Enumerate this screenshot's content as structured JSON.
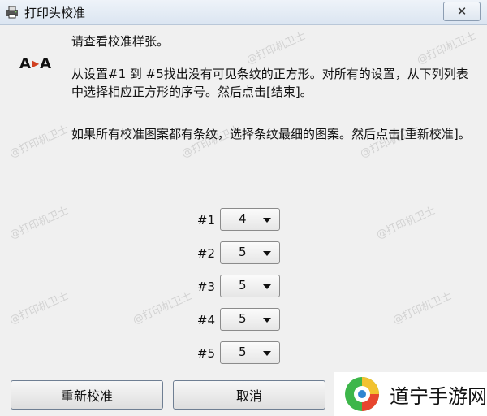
{
  "window": {
    "title": "打印头校准",
    "close_label": "✕",
    "logo_left": "A",
    "logo_right": "A"
  },
  "instructions": {
    "line1": "请查看校准样张。",
    "line2": "从设置#1 到 #5找出没有可见条纹的正方形。对所有的设置，从下列列表中选择相应正方形的序号。然后点击[结束]。",
    "line3": "如果所有校准图案都有条纹，选择条纹最细的图案。然后点击[重新校准]。"
  },
  "settings": [
    {
      "label": "#1",
      "value": "4"
    },
    {
      "label": "#2",
      "value": "5"
    },
    {
      "label": "#3",
      "value": "5"
    },
    {
      "label": "#4",
      "value": "5"
    },
    {
      "label": "#5",
      "value": "5"
    }
  ],
  "buttons": {
    "recalibrate": "重新校准",
    "cancel": "取消"
  },
  "watermark": {
    "text": "@打印机卫士"
  },
  "brand": {
    "text": "道宁手游网"
  }
}
